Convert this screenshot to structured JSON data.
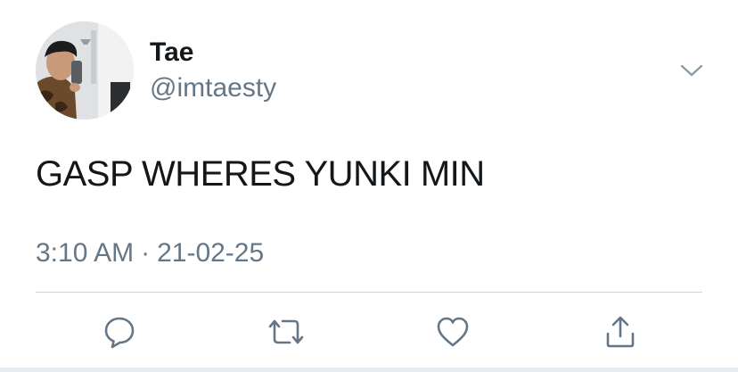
{
  "author": {
    "display_name": "Tae",
    "handle": "@imtaesty",
    "avatar_icon": "profile-photo"
  },
  "tweet": {
    "text": "GASP WHERES YUNKI MIN",
    "time": "3:10 AM",
    "separator": "·",
    "date": "21-02-25"
  },
  "actions": [
    {
      "name": "reply",
      "icon": "speech-bubble-icon"
    },
    {
      "name": "retweet",
      "icon": "retweet-arrows-icon"
    },
    {
      "name": "like",
      "icon": "heart-icon"
    },
    {
      "name": "share",
      "icon": "share-upload-icon"
    }
  ],
  "menu": {
    "icon": "chevron-down-icon"
  },
  "colors": {
    "text": "#14171a",
    "secondary": "#657786",
    "divider": "#ccd6dd",
    "icon": "#657786"
  }
}
